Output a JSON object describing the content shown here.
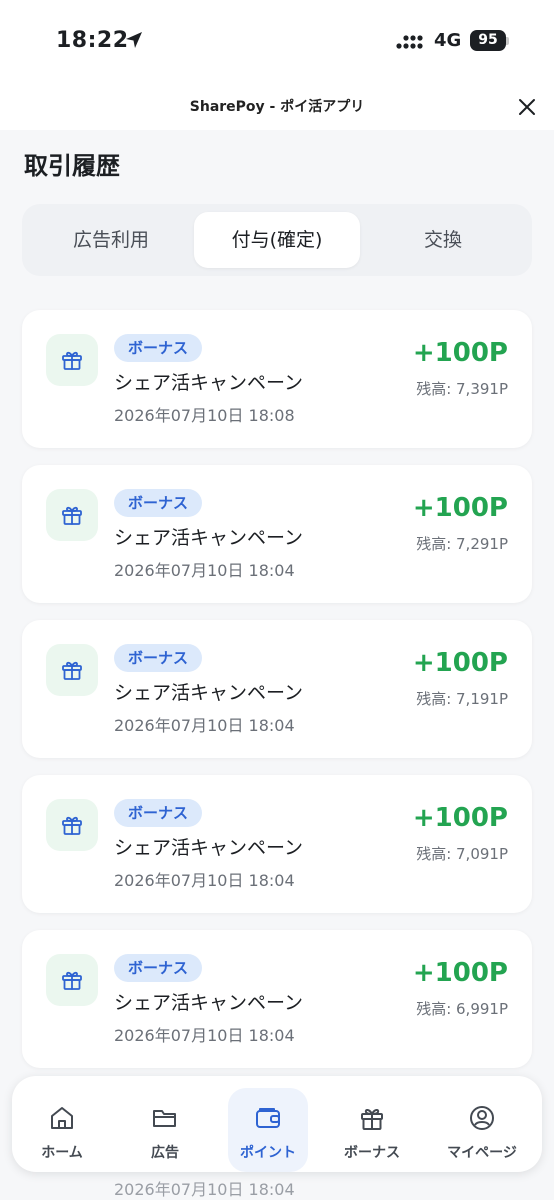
{
  "status": {
    "time": "18:22",
    "network": "4G",
    "battery": "95"
  },
  "header": {
    "title": "SharePoy - ポイ活アプリ"
  },
  "page": {
    "title": "取引履歴"
  },
  "tabs": [
    {
      "label": "広告利用",
      "active": false
    },
    {
      "label": "付与(確定)",
      "active": true
    },
    {
      "label": "交換",
      "active": false
    }
  ],
  "transactions": [
    {
      "badge": "ボーナス",
      "title": "シェア活キャンペーン",
      "date": "2026年07月10日 18:08",
      "amount": "+100P",
      "balance": "残高: 7,391P"
    },
    {
      "badge": "ボーナス",
      "title": "シェア活キャンペーン",
      "date": "2026年07月10日 18:04",
      "amount": "+100P",
      "balance": "残高: 7,291P"
    },
    {
      "badge": "ボーナス",
      "title": "シェア活キャンペーン",
      "date": "2026年07月10日 18:04",
      "amount": "+100P",
      "balance": "残高: 7,191P"
    },
    {
      "badge": "ボーナス",
      "title": "シェア活キャンペーン",
      "date": "2026年07月10日 18:04",
      "amount": "+100P",
      "balance": "残高: 7,091P"
    },
    {
      "badge": "ボーナス",
      "title": "シェア活キャンペーン",
      "date": "2026年07月10日 18:04",
      "amount": "+100P",
      "balance": "残高: 6,991P"
    },
    {
      "date": "2026年07月10日 18:04"
    }
  ],
  "nav": [
    {
      "label": "ホーム",
      "icon": "home-icon",
      "active": false
    },
    {
      "label": "広告",
      "icon": "folder-icon",
      "active": false
    },
    {
      "label": "ポイント",
      "icon": "wallet-icon",
      "active": true
    },
    {
      "label": "ボーナス",
      "icon": "gift-icon",
      "active": false
    },
    {
      "label": "マイページ",
      "icon": "user-icon",
      "active": false
    }
  ],
  "colors": {
    "accent": "#2e63d2",
    "amount": "#23a451",
    "badge_bg": "#dce9fb",
    "gift_bg": "#ebf7ef"
  }
}
